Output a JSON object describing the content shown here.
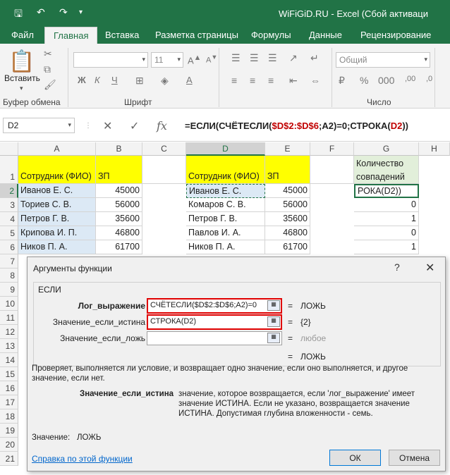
{
  "window": {
    "title": "WiFiGiD.RU - Excel (Сбой активаци"
  },
  "tabs": [
    "Файл",
    "Главная",
    "Вставка",
    "Разметка страницы",
    "Формулы",
    "Данные",
    "Рецензирование"
  ],
  "ribbon": {
    "paste_label": "Вставить",
    "font_size": "11",
    "number_format": "Общий",
    "bold": "Ж",
    "italic": "К",
    "underline": "Ч",
    "groups": [
      "Буфер обмена",
      "Шрифт",
      "Число"
    ]
  },
  "formula_bar": {
    "name_box": "D2",
    "fx": "fx",
    "formula_prefix": "=ЕСЛИ(СЧЁТЕСЛИ(",
    "formula_range": "$D$2:$D$6",
    "formula_mid": ";A2)=0;СТРОКА(",
    "formula_ref": "D2",
    "formula_suffix": "))"
  },
  "grid": {
    "columns": [
      "A",
      "B",
      "C",
      "D",
      "E",
      "F",
      "G",
      "H"
    ],
    "rows": [
      "1",
      "2",
      "3",
      "4",
      "5",
      "6",
      "7",
      "8",
      "9",
      "10",
      "11",
      "12",
      "13",
      "14",
      "15",
      "16",
      "17",
      "18",
      "19",
      "20",
      "21"
    ],
    "a_header": "Сотрудник (ФИО)",
    "b_header": "ЗП",
    "d_header": "Сотрудник (ФИО)",
    "e_header": "ЗП",
    "g_header": "Количество совпадений",
    "table1": [
      {
        "name": "Иванов Е. С.",
        "zp": "45000"
      },
      {
        "name": "Ториев С. В.",
        "zp": "56000"
      },
      {
        "name": "Петров Г. В.",
        "zp": "35600"
      },
      {
        "name": "Крипова И. П.",
        "zp": "46800"
      },
      {
        "name": "Ников П. А.",
        "zp": "61700"
      }
    ],
    "table2": [
      {
        "name": "Иванов Е. С.",
        "zp": "45000"
      },
      {
        "name": "Комаров С. В.",
        "zp": "56000"
      },
      {
        "name": "Петров Г. В.",
        "zp": "35600"
      },
      {
        "name": "Павлов И. А.",
        "zp": "46800"
      },
      {
        "name": "Ников П. А.",
        "zp": "61700"
      }
    ],
    "g_values": [
      "РОКА(D2))",
      "0",
      "1",
      "0",
      "1"
    ]
  },
  "dialog": {
    "title": "Аргументы функции",
    "help": "?",
    "close": "✕",
    "function_name": "ЕСЛИ",
    "args": [
      {
        "label": "Лог_выражение",
        "value": "СЧЁТЕСЛИ($D$2:$D$6;A2)=0",
        "result": "ЛОЖЬ"
      },
      {
        "label": "Значение_если_истина",
        "value": "СТРОКА(D2)",
        "result": "{2}"
      },
      {
        "label": "Значение_если_ложь",
        "value": "",
        "result": "любое"
      }
    ],
    "overall_result": "ЛОЖЬ",
    "description": "Проверяет, выполняется ли условие, и возвращает одно значение, если оно выполняется, и другое значение, если нет.",
    "arg_help_name": "Значение_если_истина",
    "arg_help_text": "значение, которое возвращается, если 'лог_выражение' имеет значение ИСТИНА. Если не указано, возвращается значение ИСТИНА. Допустимая глубина вложенности - семь.",
    "value_label": "Значение:",
    "value_result": "ЛОЖЬ",
    "help_link": "Справка по этой функции",
    "ok": "ОК",
    "cancel": "Отмена"
  }
}
